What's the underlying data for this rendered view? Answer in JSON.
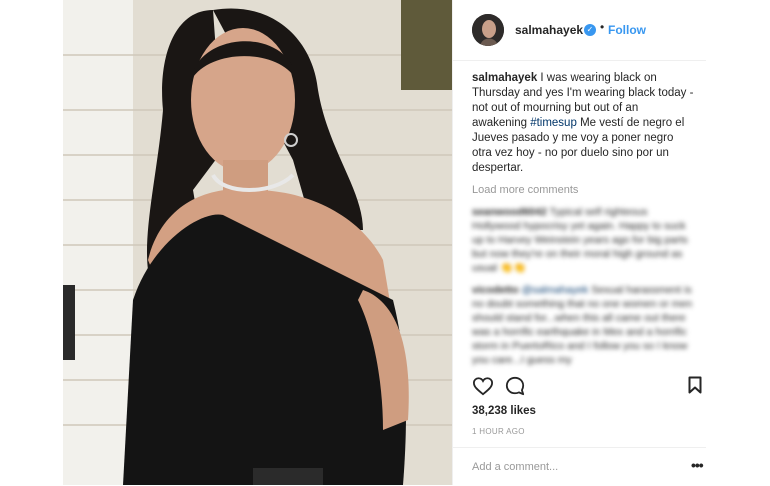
{
  "post": {
    "username": "salmahayek",
    "follow_label": "Follow",
    "separator": "•",
    "verified_icon": "✓",
    "caption": {
      "author": "salmahayek",
      "text_before": "I was wearing black on Thursday and yes I'm wearing black today - not out of mourning but out of an awakening",
      "hashtag": "#timesup",
      "text_after": "Me vestí de negro el Jueves pasado y me voy a poner negro otra vez hoy - no por duelo sino por un despertar."
    },
    "load_more_label": "Load more comments",
    "comments": [
      {
        "user": "seanwood6042",
        "mention": "",
        "text": "Typical self righteous Hollywood hypocrisy yet again. Happy to suck up to Harvey Weinstein years ago for big parts but now they're on their moral high ground as usual 👏👏"
      },
      {
        "user": "vicodetto",
        "mention": "@salmahayek",
        "text": "Sexual harassment is no doubt something that no one women or men should stand for...when this all came out there was a horrific earthquake in Mex and a horrific storm in PuertoRico and I follow you so I know you care...I guess my"
      }
    ],
    "likes": "38,238 likes",
    "time_ago": "1 HOUR AGO",
    "add_comment_placeholder": "Add a comment...",
    "more_options": "•••",
    "icons": {
      "like": "heart-icon",
      "comment": "comment-bubble-icon",
      "save": "bookmark-icon",
      "more": "more-options-icon"
    }
  }
}
